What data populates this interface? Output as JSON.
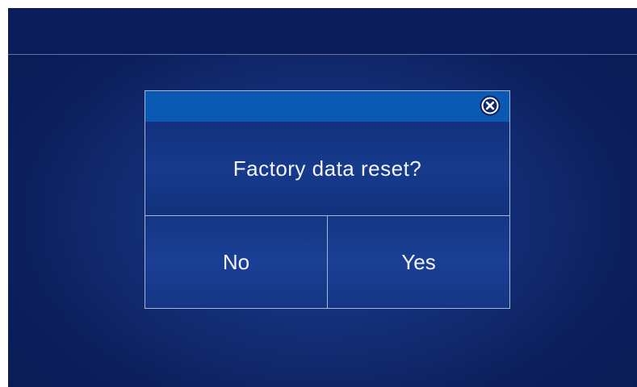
{
  "dialog": {
    "message": "Factory data reset?",
    "no_label": "No",
    "yes_label": "Yes",
    "close_icon": "close-circle-icon"
  },
  "colors": {
    "background": "#0c1f5c",
    "titlebar": "#0a5ab4",
    "border": "#a8b6d6",
    "text": "#f2f4fa"
  }
}
